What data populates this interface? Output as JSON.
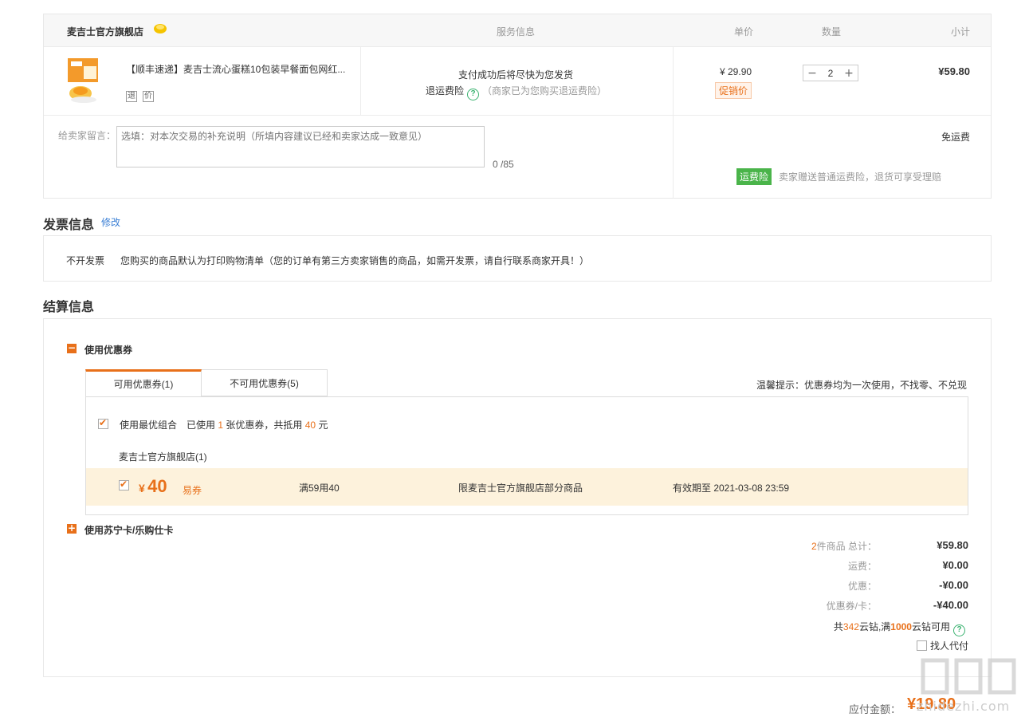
{
  "order": {
    "shop_name": "麦吉士官方旗舰店",
    "columns": {
      "service": "服务信息",
      "unit_price": "单价",
      "quantity": "数量",
      "subtotal": "小计"
    },
    "product": {
      "title": "【顺丰速递】麦吉士流心蛋糕10包装早餐面包网红...",
      "icon_labels": [
        "退",
        "价"
      ],
      "service_line1": "支付成功后将尽快为您发货",
      "return_insurance": "退运费险",
      "return_note": "（商家已为您购买退运费险）",
      "price": "¥ 29.90",
      "promo_tag": "促销价",
      "quantity": "2",
      "subtotal": "¥59.80"
    },
    "message": {
      "label": "给卖家留言：",
      "placeholder": "选填：对本次交易的补充说明（所填内容建议已经和卖家达成一致意见）",
      "counter": "0 /85"
    },
    "shipping": "免运费",
    "insurance_tag": "运费险",
    "insurance_note": "卖家赠送普通运费险，退货可享受理赔"
  },
  "invoice": {
    "title": "发票信息",
    "edit": "修改",
    "type": "不开发票",
    "text": "您购买的商品默认为打印购物清单（您的订单有第三方卖家销售的商品，如需开发票，请自行联系商家开具！）"
  },
  "settlement": {
    "title": "结算信息",
    "coupon_section": "使用优惠券",
    "tabs": [
      "可用优惠券(1)",
      "不可用优惠券(5)"
    ],
    "tips": "温馨提示：优惠券均为一次使用，不找零、不兑现",
    "best_combo_label": "使用最优组合",
    "best_info_prefix": "已使用",
    "best_info_count": "1",
    "best_info_mid": "张优惠券，共抵用",
    "best_info_amount": "40",
    "best_info_suffix": "元",
    "store": "麦吉士官方旗舰店(1)",
    "coupon": {
      "currency": "¥",
      "amount": "40",
      "type": "易券",
      "condition": "满59用40",
      "scope": "限麦吉士官方旗舰店部分商品",
      "expire": "有效期至 2021-03-08 23:59"
    },
    "card_section": "使用苏宁卡/乐购仕卡",
    "summary": {
      "count": "2",
      "count_label": "件商品 总计：",
      "total": "¥59.80",
      "freight_label": "运费：",
      "freight": "¥0.00",
      "discount_label": "优惠：",
      "discount": "-¥0.00",
      "coupon_label": "优惠券/卡：",
      "coupon": "-¥40.00"
    },
    "yunzuan": {
      "prefix": "共",
      "count": "342",
      "mid": "云钻,满",
      "threshold": "1000",
      "suffix": "云钻可用"
    },
    "proxy_pay": "找人代付"
  },
  "payment": {
    "label": "应付金额：",
    "amount": "¥19.80"
  },
  "watermark": "zhidezhi.com",
  "colors": {
    "accent": "#e8701a",
    "green": "#4ab44a",
    "link": "#3a7fd5"
  }
}
